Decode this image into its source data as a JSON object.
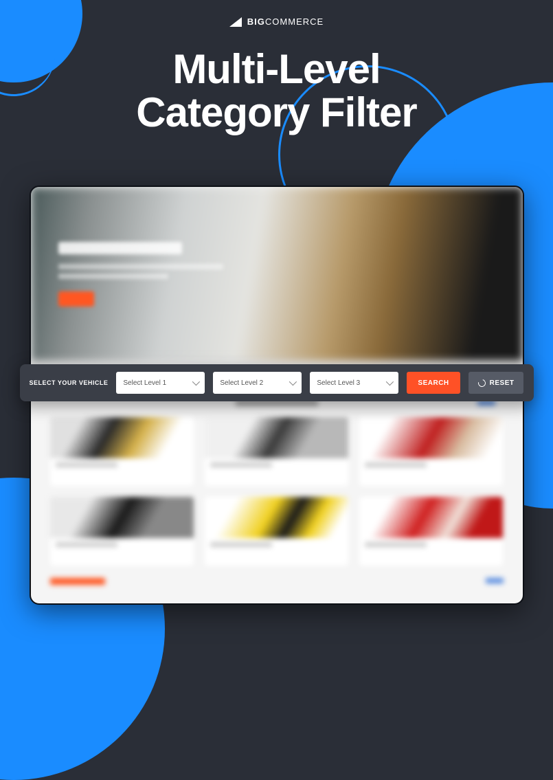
{
  "brand": {
    "bold": "BIG",
    "thin": "COMMERCE"
  },
  "title_line1": "Multi-Level",
  "title_line2": "Category Filter",
  "filter": {
    "label": "SELECT YOUR VEHICLE",
    "level1": "Select Level 1",
    "level2": "Select Level 2",
    "level3": "Select Level 3",
    "search_label": "SEARCH",
    "reset_label": "RESET"
  }
}
